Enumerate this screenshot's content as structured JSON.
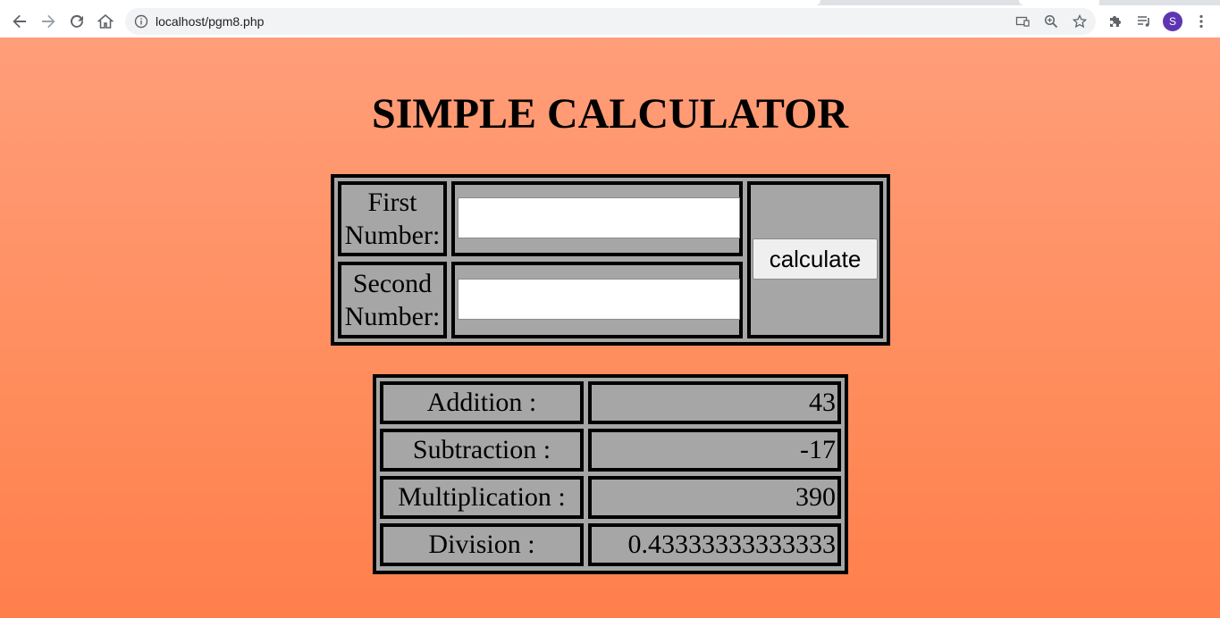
{
  "browser": {
    "url": "localhost/pgm8.php",
    "avatar_letter": "S"
  },
  "page": {
    "title": "SIMPLE CALCULATOR",
    "form": {
      "first_label": "First Number:",
      "first_value": "",
      "second_label": "Second Number:",
      "second_value": "",
      "button_label": "calculate"
    },
    "results": [
      {
        "label": "Addition :",
        "value": "43"
      },
      {
        "label": "Subtraction :",
        "value": "-17"
      },
      {
        "label": "Multiplication :",
        "value": "390"
      },
      {
        "label": "Division :",
        "value": "0.43333333333333"
      }
    ]
  },
  "colors": {
    "background_top": "#ff9e7a",
    "background_bottom": "#ff7f4c",
    "table_fill": "#a6a6a6",
    "avatar": "#5e35b1"
  }
}
